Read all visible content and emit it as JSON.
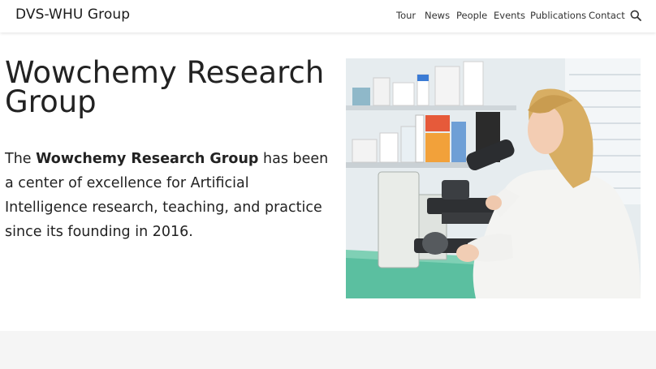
{
  "navbar": {
    "brand": "DVS-WHU Group",
    "items": [
      {
        "label": "Tour"
      },
      {
        "label": "News"
      },
      {
        "label": "People"
      },
      {
        "label": "Events"
      },
      {
        "label": "Publications"
      },
      {
        "label": "Contact"
      }
    ],
    "search_icon": "search-icon"
  },
  "hero": {
    "title": "Wowchemy Research Group",
    "text_prefix": "The ",
    "text_bold": "Wowchemy Research Group",
    "text_suffix": " has been a center of excellence for Artificial Intelligence research, teaching, and practice since its founding in 2016.",
    "image_icon": "scientist-microscope-photo"
  },
  "colors": {
    "text": "#222222",
    "navbar_bg": "#ffffff",
    "footer_band": "#f5f5f5"
  }
}
